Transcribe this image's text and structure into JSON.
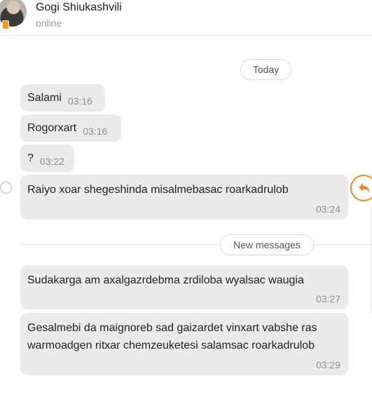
{
  "header": {
    "contact_name": "Gogi Shiukashvili",
    "status": "online",
    "badge_color": "#f39a1e"
  },
  "dividers": {
    "today": "Today",
    "new_messages": "New messages"
  },
  "messages": [
    {
      "text": "Salami",
      "time": "03:16"
    },
    {
      "text": "Rogorxart",
      "time": "03:16"
    },
    {
      "text": "?",
      "time": "03:22"
    },
    {
      "text": "Raiyo xoar shegeshinda misalmebasac roarkadrulob",
      "time": "03:24"
    },
    {
      "text": "Sudakarga am axalgazrdebma zrdiloba wyalsac waugia",
      "time": "03:27"
    },
    {
      "text": "Gesalmebi da maignoreb sad gaizardet vinxart vabshe ras warmoadgen ritxar chemzeuketesi salamsac roarkadrulob",
      "time": "03:29"
    }
  ],
  "icons": {
    "reply": "reply-arrow-icon",
    "select": "select-circle-icon"
  },
  "colors": {
    "accent": "#f08a24",
    "bubble": "#ebebeb"
  }
}
